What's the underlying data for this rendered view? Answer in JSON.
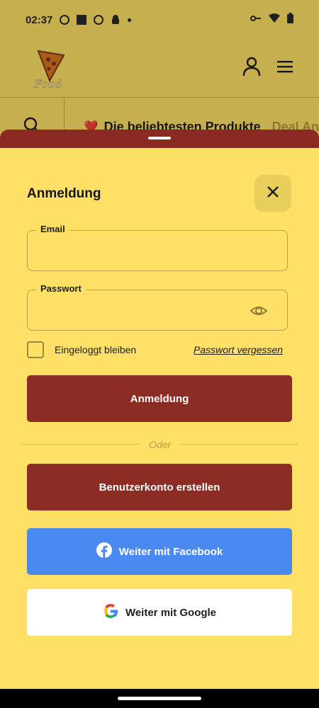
{
  "status_bar": {
    "time": "02:37"
  },
  "header": {
    "logo_text": "Food"
  },
  "promo": {
    "heart": "❤️",
    "title": "Die beliebtesten Produkte",
    "next": "Deal An"
  },
  "login": {
    "title": "Anmeldung",
    "email_label": "Email",
    "email_value": "",
    "password_label": "Passwort",
    "password_value": "",
    "remember_label": "Eingeloggt bleiben",
    "forgot_label": "Passwort vergessen",
    "login_button": "Anmeldung",
    "or_text": "Oder",
    "register_button": "Benutzerkonto erstellen",
    "facebook_button": "Weiter mit Facebook",
    "google_button": "Weiter mit Google"
  },
  "colors": {
    "background": "#FEE066",
    "primary": "#8B2D24",
    "facebook": "#4A8AF0",
    "google_bg": "#FFFFFF"
  },
  "icons": [
    "user-icon",
    "menu-icon",
    "search-icon",
    "close-icon",
    "eye-icon",
    "facebook-icon",
    "google-icon"
  ]
}
